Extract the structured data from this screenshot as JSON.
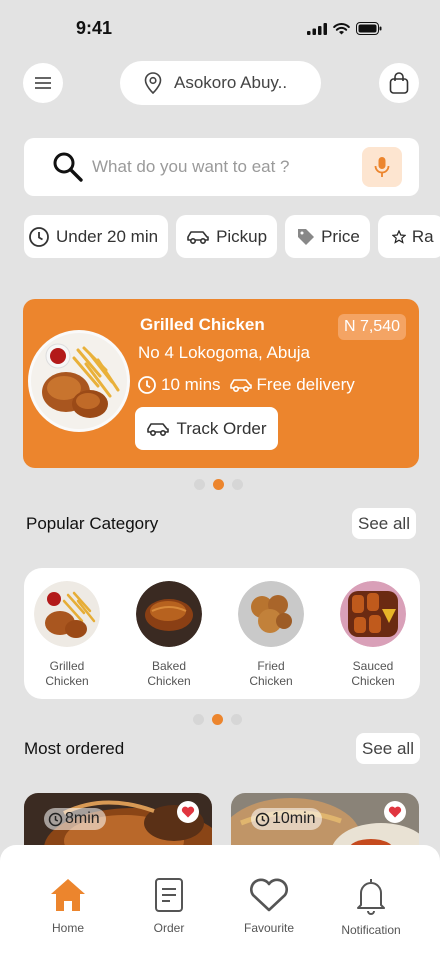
{
  "status_bar": {
    "time": "9:41"
  },
  "header": {
    "location": "Asokoro Abuy.."
  },
  "search": {
    "placeholder": "What do you want to eat ?"
  },
  "filters": [
    {
      "label": "Under 20 min",
      "icon": "clock-icon"
    },
    {
      "label": "Pickup",
      "icon": "car-icon"
    },
    {
      "label": "Price",
      "icon": "tag-icon"
    },
    {
      "label": "Ra",
      "icon": "star-icon"
    }
  ],
  "promo": {
    "title": "Grilled Chicken",
    "price": "N 7,540",
    "address": "No 4 Lokogoma, Abuja",
    "time": "10 mins",
    "delivery": "Free delivery",
    "track_label": "Track Order",
    "carousel_active": 1,
    "carousel_count": 3
  },
  "popular": {
    "title": "Popular Category",
    "see_all": "See all",
    "items": [
      {
        "line1": "Grilled",
        "line2": "Chicken"
      },
      {
        "line1": "Baked",
        "line2": "Chicken"
      },
      {
        "line1": "Fried",
        "line2": "Chicken"
      },
      {
        "line1": "Sauced",
        "line2": "Chicken"
      }
    ],
    "carousel_active": 1,
    "carousel_count": 3
  },
  "most_ordered": {
    "title": "Most ordered",
    "see_all": "See all",
    "items": [
      {
        "time": "8min"
      },
      {
        "time": "10min"
      }
    ]
  },
  "nav": {
    "items": [
      {
        "label": "Home",
        "icon": "home-icon",
        "active": true
      },
      {
        "label": "Order",
        "icon": "order-icon",
        "active": false
      },
      {
        "label": "Favourite",
        "icon": "heart-icon",
        "active": false
      },
      {
        "label": "Notification",
        "icon": "bell-icon",
        "active": false
      }
    ]
  },
  "colors": {
    "accent": "#EC852D",
    "background": "#E3E3E3",
    "card": "#FFFFFF"
  }
}
